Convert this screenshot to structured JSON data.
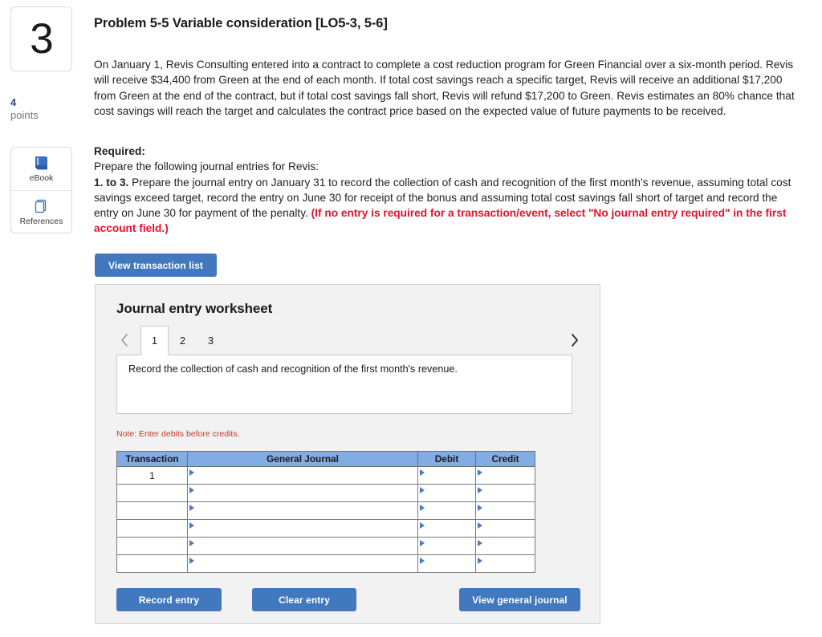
{
  "sidebar": {
    "question_number": "3",
    "points_value": "4",
    "points_label": "points",
    "tools": [
      {
        "id": "ebook",
        "label": "eBook",
        "icon": "book-icon"
      },
      {
        "id": "references",
        "label": "References",
        "icon": "pages-stack-icon"
      }
    ]
  },
  "question": {
    "title": "Problem 5-5 Variable consideration [LO5-3, 5-6]",
    "body": "On January 1, Revis Consulting entered into a contract to complete a cost reduction program for Green Financial over a six-month period. Revis will receive $34,400 from Green at the end of each month. If total cost savings reach a specific target, Revis will receive an additional $17,200 from Green at the end of the contract, but if total cost savings fall short, Revis will refund $17,200 to Green. Revis estimates an 80% chance that cost savings will reach the target and calculates the contract price based on the expected value of future payments to be received.",
    "required_heading": "Required:",
    "required_line1": "Prepare the following journal entries for Revis:",
    "required_prefix": "1. to 3.",
    "required_line2": " Prepare the journal entry on January 31 to record the collection of cash and recognition of the first month's revenue, assuming total cost savings exceed target, record the entry on June 30 for receipt of the bonus and assuming total cost savings fall short of target and record the entry on June 30 for payment of the penalty. ",
    "required_note_red": "(If no entry is required for a transaction/event, select \"No journal entry required\" in the first account field.)"
  },
  "toolbar": {
    "view_transaction_list_label": "View transaction list"
  },
  "worksheet": {
    "title": "Journal entry worksheet",
    "prev_label": "‹",
    "next_label": "›",
    "tabs": [
      {
        "label": "1",
        "active": true
      },
      {
        "label": "2",
        "active": false
      },
      {
        "label": "3",
        "active": false
      }
    ],
    "description": "Record the collection of cash and recognition of the first month's revenue.",
    "note": "Note: Enter debits before credits.",
    "table": {
      "headers": [
        "Transaction",
        "General Journal",
        "Debit",
        "Credit"
      ],
      "rows": [
        {
          "transaction": "1",
          "general_journal": "",
          "debit": "",
          "credit": ""
        },
        {
          "transaction": "",
          "general_journal": "",
          "debit": "",
          "credit": ""
        },
        {
          "transaction": "",
          "general_journal": "",
          "debit": "",
          "credit": ""
        },
        {
          "transaction": "",
          "general_journal": "",
          "debit": "",
          "credit": ""
        },
        {
          "transaction": "",
          "general_journal": "",
          "debit": "",
          "credit": ""
        },
        {
          "transaction": "",
          "general_journal": "",
          "debit": "",
          "credit": ""
        }
      ]
    },
    "buttons": {
      "record_entry": "Record entry",
      "clear_entry": "Clear entry",
      "view_general_journal": "View general journal"
    }
  },
  "colors": {
    "button_blue": "#4178be",
    "table_header_blue": "#83abe4",
    "alert_red": "#e8112d",
    "note_red": "#c0392b",
    "panel_bg": "#f2f2f2"
  }
}
